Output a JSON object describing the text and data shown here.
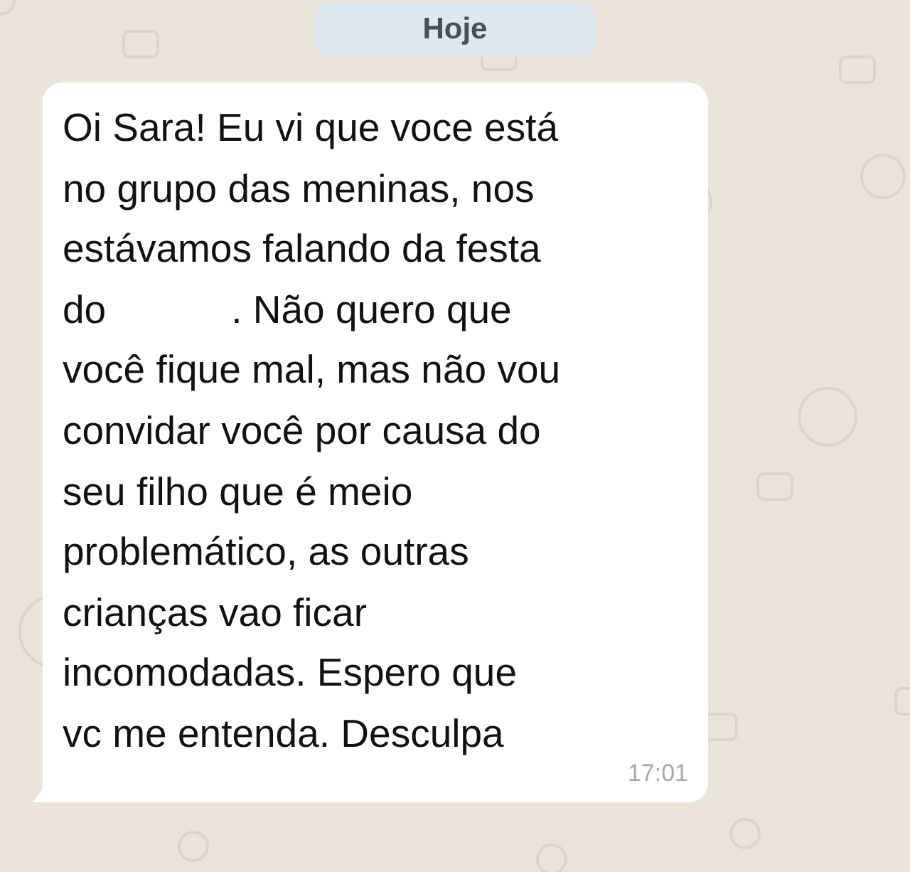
{
  "date_badge": {
    "label": "Hoje"
  },
  "message": {
    "lines": [
      {
        "text": "Oi Sara! Eu vi que voce está"
      },
      {
        "text": "no grupo das meninas, nos"
      },
      {
        "text": "estávamos falando da festa"
      },
      {
        "text": "do",
        "after_redaction": ". Não quero que"
      },
      {
        "text": "você fique mal, mas não vou"
      },
      {
        "text": "convidar você por causa do"
      },
      {
        "text": "seu filho que é meio"
      },
      {
        "text": "problemático, as outras"
      },
      {
        "text": "crianças vao ficar"
      },
      {
        "text": "incomodadas. Espero que"
      },
      {
        "text": "vc me entenda. Desculpa"
      }
    ],
    "time": "17:01"
  }
}
